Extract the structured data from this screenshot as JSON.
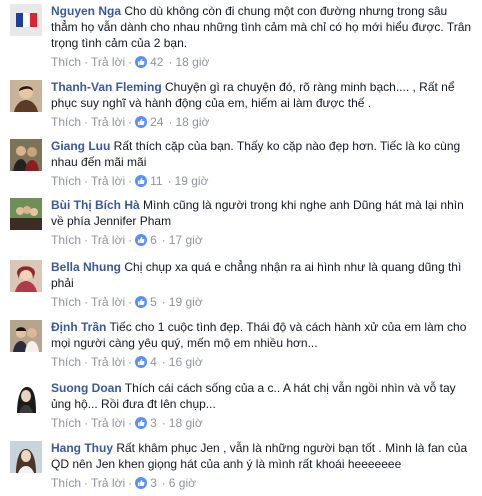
{
  "comments": [
    {
      "author": "Nguyen Nga",
      "text": "Cho dù không còn đi chung một con đường nhưng trong sâu thẳm họ vẫn dành cho nhau những tình cảm mà chỉ có họ mới hiểu được. Trân trọng tình cảm của 2 bạn.",
      "like_label": "Thích",
      "reply_label": "Trả lời",
      "likes": "42",
      "time": "18 giờ"
    },
    {
      "author": "Thanh-Van Fleming",
      "text": "Chuyện gì ra chuyện đó, rõ ràng minh bạch.... , Rất nể phục suy nghĩ và hành động của em, hiếm ai làm được thế .",
      "like_label": "Thích",
      "reply_label": "Trả lời",
      "likes": "24",
      "time": "18 giờ"
    },
    {
      "author": "Giang Luu",
      "text": "Rất thích cặp của bạn. Thấy ko cặp nào đẹp hơn. Tiếc là ko cùng nhau đến mãi mãi",
      "like_label": "Thích",
      "reply_label": "Trả lời",
      "likes": "11",
      "time": "19 giờ"
    },
    {
      "author": "Bùi Thị Bích Hà",
      "text": "Mình cũng là người trong khi nghe anh Dũng hát mà lại nhìn về phía Jennifer Pham",
      "like_label": "Thích",
      "reply_label": "Trả lời",
      "likes": "6",
      "time": "17 giờ"
    },
    {
      "author": "Bella Nhung",
      "text": "Chị chụp xa quá e chẳng nhận ra ai hình như là quang dũng thì phải",
      "like_label": "Thích",
      "reply_label": "Trả lời",
      "likes": "5",
      "time": "19 giờ"
    },
    {
      "author": "Định Trần",
      "text": "Tiếc cho 1 cuộc tình đẹp. Thái độ và cách hành xử của em làm cho mọi người càng yêu quý, mến mộ em nhiều hơn...",
      "like_label": "Thích",
      "reply_label": "Trả lời",
      "likes": "4",
      "time": "16 giờ"
    },
    {
      "author": "Suong Doan",
      "text": "Thích cái cách sống của a c.. A hát chị vẫn ngồi nhìn và vỗ tay ủng hộ... Rồi đưa đt lên chụp...",
      "like_label": "Thích",
      "reply_label": "Trả lời",
      "likes": "3",
      "time": "18 giờ"
    },
    {
      "author": "Hang Thuy",
      "text": "Rất khâm phục Jen , vẫn là những người bạn tốt . Mình là fan của QD nên Jen khen giọng hát của anh ý là mình rất khoái heeeeeee",
      "like_label": "Thích",
      "reply_label": "Trả lời",
      "likes": "3",
      "time": "6 giờ"
    }
  ],
  "colors": {
    "author": "#3b5998",
    "meta": "#90949c",
    "like_badge": "#5890ff"
  },
  "icons": {
    "like_badge": "thumbs-up-icon"
  }
}
